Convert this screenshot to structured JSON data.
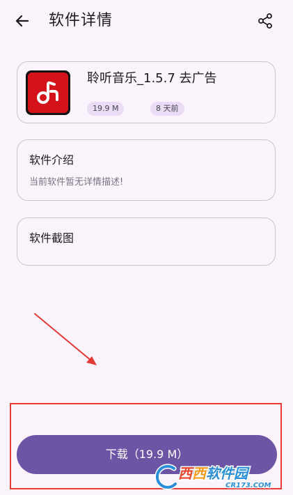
{
  "header": {
    "title": "软件详情",
    "back_icon": "arrow-left-icon",
    "share_icon": "share-icon"
  },
  "app": {
    "name": "聆听音乐_1.5.7 去广告",
    "size": "19.9 M",
    "updated": "8 天前",
    "icon": "music-note-icon"
  },
  "intro": {
    "title": "软件介绍",
    "description": "当前软件暂无详情描述!"
  },
  "screenshots": {
    "title": "软件截图"
  },
  "download": {
    "label": "下载（19.9 M）"
  },
  "watermark": {
    "brand": "西西软件园",
    "site": "CR173.COM"
  },
  "colors": {
    "background": "#fbf4fd",
    "primary": "#6d55a6",
    "chip": "#e9ddf5",
    "annotation": "#e53935",
    "app_icon": "#d4121a"
  }
}
